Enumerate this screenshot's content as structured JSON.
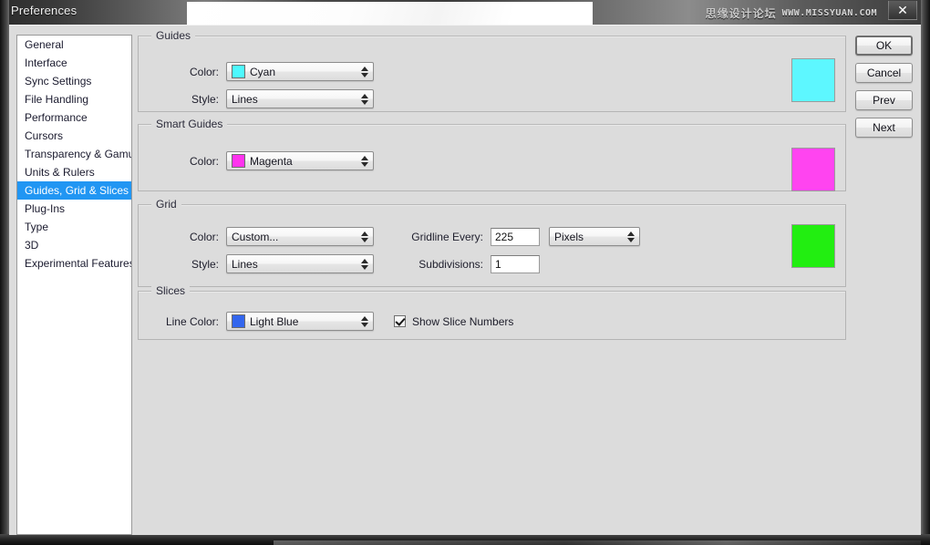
{
  "window": {
    "title": "Preferences",
    "close_icon": "close-icon",
    "watermark_cn": "思缘设计论坛",
    "watermark_url": "WWW.MISSYUAN.COM"
  },
  "sidebar": {
    "items": [
      {
        "label": "General",
        "selected": false
      },
      {
        "label": "Interface",
        "selected": false
      },
      {
        "label": "Sync Settings",
        "selected": false
      },
      {
        "label": "File Handling",
        "selected": false
      },
      {
        "label": "Performance",
        "selected": false
      },
      {
        "label": "Cursors",
        "selected": false
      },
      {
        "label": "Transparency & Gamut",
        "selected": false
      },
      {
        "label": "Units & Rulers",
        "selected": false
      },
      {
        "label": "Guides, Grid & Slices",
        "selected": true
      },
      {
        "label": "Plug-Ins",
        "selected": false
      },
      {
        "label": "Type",
        "selected": false
      },
      {
        "label": "3D",
        "selected": false
      },
      {
        "label": "Experimental Features",
        "selected": false
      }
    ]
  },
  "groups": {
    "guides": {
      "title": "Guides",
      "color_label": "Color:",
      "color_value": "Cyan",
      "color_swatch": "#4DF9FF",
      "style_label": "Style:",
      "style_value": "Lines",
      "preview_color": "#5DF7FF"
    },
    "smart_guides": {
      "title": "Smart Guides",
      "color_label": "Color:",
      "color_value": "Magenta",
      "color_swatch": "#FF33EE",
      "preview_color": "#FF44F0"
    },
    "grid": {
      "title": "Grid",
      "color_label": "Color:",
      "color_value": "Custom...",
      "style_label": "Style:",
      "style_value": "Lines",
      "gridline_label": "Gridline Every:",
      "gridline_value": "225",
      "unit_value": "Pixels",
      "subdivisions_label": "Subdivisions:",
      "subdivisions_value": "1",
      "preview_color": "#22EE11"
    },
    "slices": {
      "title": "Slices",
      "line_color_label": "Line Color:",
      "line_color_value": "Light Blue",
      "line_color_swatch": "#3366EE",
      "checkbox_label": "Show Slice Numbers",
      "checkbox_checked": true
    }
  },
  "buttons": {
    "ok": "OK",
    "cancel": "Cancel",
    "prev": "Prev",
    "next": "Next"
  }
}
